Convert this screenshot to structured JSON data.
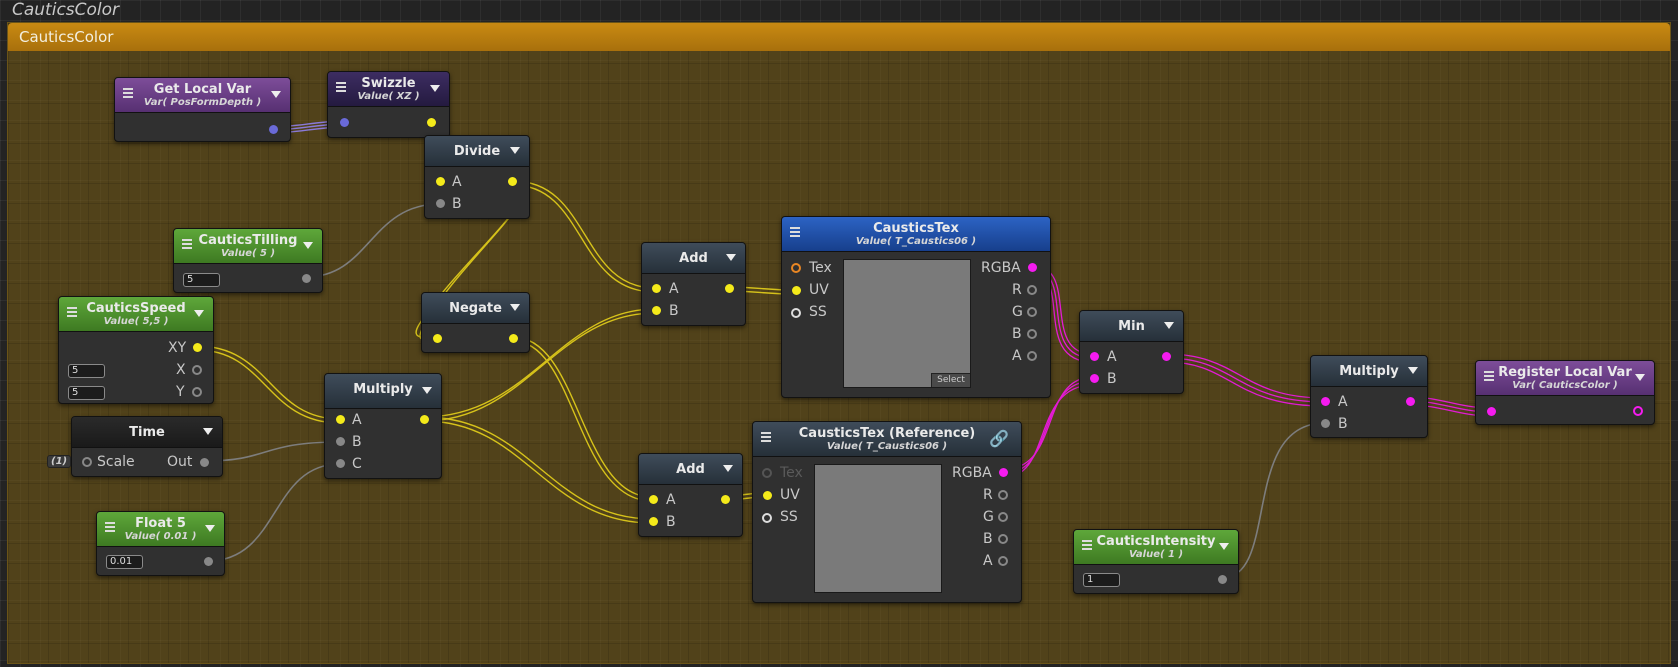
{
  "graph_title": "CauticsColor",
  "group_title": "CauticsColor",
  "colors": {
    "float_port": "#f4ea1a",
    "color_port": "#f51bf0",
    "vector_port": "#6a6ad8",
    "group_header": "#c98a12"
  },
  "nodes": {
    "get_local_var": {
      "title": "Get Local Var",
      "subtitle": "Var( PosFormDepth )"
    },
    "swizzle": {
      "title": "Swizzle",
      "subtitle": "Value( XZ )"
    },
    "divide": {
      "title": "Divide",
      "in_a": "A",
      "in_b": "B"
    },
    "tilling": {
      "title": "CauticsTilling",
      "subtitle": "Value( 5 )",
      "field": "5"
    },
    "speed": {
      "title": "CauticsSpeed",
      "subtitle": "Value( 5,5 )",
      "out_xy": "XY",
      "out_x": "X",
      "out_y": "Y",
      "field_x": "5",
      "field_y": "5"
    },
    "negate": {
      "title": "Negate"
    },
    "multiply1": {
      "title": "Multiply",
      "in_a": "A",
      "in_b": "B",
      "in_c": "C"
    },
    "time": {
      "title": "Time",
      "scale_badge": "(1)",
      "in_scale": "Scale",
      "out": "Out"
    },
    "float5": {
      "title": "Float 5",
      "subtitle": "Value( 0.01 )",
      "field": "0.01"
    },
    "add1": {
      "title": "Add",
      "in_a": "A",
      "in_b": "B"
    },
    "add2": {
      "title": "Add",
      "in_a": "A",
      "in_b": "B"
    },
    "tex1": {
      "title": "CausticsTex",
      "subtitle": "Value( T_Caustics06 )",
      "in_tex": "Tex",
      "in_uv": "UV",
      "in_ss": "SS",
      "out_rgba": "RGBA",
      "out_r": "R",
      "out_g": "G",
      "out_b": "B",
      "out_a": "A",
      "select": "Select"
    },
    "tex2": {
      "title": "CausticsTex (Reference)",
      "subtitle": "Value( T_Caustics06 )",
      "in_tex": "Tex",
      "in_uv": "UV",
      "in_ss": "SS",
      "out_rgba": "RGBA",
      "out_r": "R",
      "out_g": "G",
      "out_b": "B",
      "out_a": "A"
    },
    "min": {
      "title": "Min",
      "in_a": "A",
      "in_b": "B"
    },
    "multiply2": {
      "title": "Multiply",
      "in_a": "A",
      "in_b": "B"
    },
    "intensity": {
      "title": "CauticsIntensity",
      "subtitle": "Value( 1 )",
      "field": "1"
    },
    "register": {
      "title": "Register Local Var",
      "subtitle": "Var( CauticsColor )"
    }
  }
}
